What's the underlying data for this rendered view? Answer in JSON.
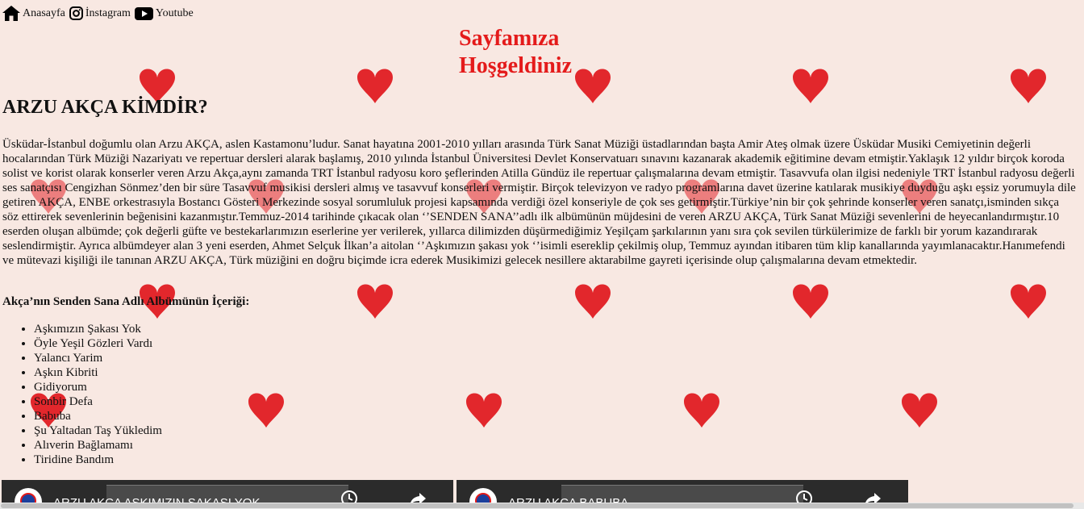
{
  "nav": {
    "home_label": "Anasayfa",
    "instagram_label": "İnstagram",
    "youtube_label": "Youtube"
  },
  "welcome": {
    "line1": "Sayfamıza",
    "line2": "Hoşgeldiniz"
  },
  "article": {
    "title": "ARZU AKÇA KİMDİR?",
    "bio": "Üsküdar-İstanbul doğumlu olan Arzu AKÇA, aslen Kastamonu’ludur. Sanat hayatına 2001-2010 yılları arasında Türk Sanat Müziği üstadlarından başta Amir Ateş olmak üzere Üsküdar Musiki Cemiyetinin değerli hocalarından Türk Müziği Nazariyatı ve repertuar dersleri alarak başlamış, 2010 yılında İstanbul Üniversitesi Devlet Konservatuarı sınavını kazanarak akademik eğitimine devam etmiştir.Yaklaşık 12 yıldır birçok koroda solist ve korist olarak konserler veren Arzu Akça,aynı zamanda TRT İstanbul radyosu koro şeflerinden Atilla Gündüz ile repertuar çalışmalarına devam etmiştir. Tasavvufa olan ilgisi nedeniyle TRT İstanbul radyosu değerli ses sanatçısı Cengizhan Sönmez’den bir süre Tasavvuf musikisi dersleri almış ve tasavvuf konserleri vermiştir. Birçok televizyon ve radyo programlarına davet üzerine katılarak musikiye duyduğu aşkı eşsiz yorumuyla dile getiren AKÇA, ENBE orkestrasıyla Bostancı Gösteri Merkezinde sosyal sorumluluk projesi kapsamında verdiği özel konseriyle de çok ses getirmiştir.Türkiye’nin bir çok şehrinde konserler veren sanatçı,isminden sıkça söz ettirerek sevenlerinin beğenisini kazanmıştır.Temmuz-2014 tarihinde çıkacak olan ‘’SENDEN SANA’’adlı ilk albümünün müjdesini de veren ARZU AKÇA, Türk Sanat Müziği sevenlerini de heyecanlandırmıştır.10 eserden oluşan albümde; çok değerli güfte ve bestekarlarımızın eserlerine yer verilerek, yıllarca dilimizden düşürmediğimiz Yeşilçam şarkılarının yanı sıra çok sevilen türkülerimize de farklı bir yorum kazandırarak seslendirmiştir. Ayrıca albümdeyer alan 3 yeni eserden, Ahmet Selçuk İlkan’a aitolan ‘’Aşkımızın şakası yok ‘’isimli esereklip çekilmiş olup, Temmuz ayından itibaren tüm klip kanallarında yayımlanacaktır.Hanımefendi ve mütevazi kişiliği ile tanınan ARZU AKÇA, Türk müziğini en doğru biçimde icra ederek Musikimizi gelecek nesillere aktarabilme gayreti içerisinde olup çalışmalarına devam etmektedir.",
    "album_heading": "Akça’nın Senden Sana Adlı Albümünün İçeriği:",
    "songs": [
      "Aşkımızın Şakası Yok",
      "Öyle Yeşil Gözleri Vardı",
      "Yalancı Yarim",
      "Aşkın Kibriti",
      "Gidiyorum",
      "Sonbir Defa",
      "Babuba",
      "Şu Yaltadan Taş Yükledim",
      "Alıverin Bağlamamı",
      "Tiridine Bandım"
    ]
  },
  "videos": [
    {
      "title": "ARZU AKÇA AŞKIMIZIN ŞAKASI YOK"
    },
    {
      "title": "ARZU AKÇA BABUBA"
    }
  ],
  "colors": {
    "background": "#f8e8e2",
    "heart": "#e0161c",
    "welcome_text": "#e41b1b"
  }
}
